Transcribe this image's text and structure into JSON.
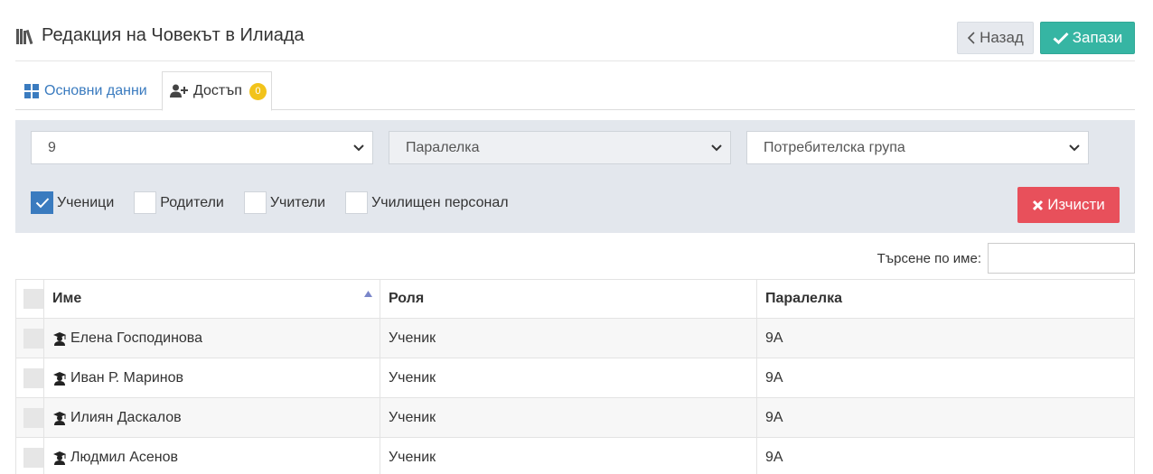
{
  "header": {
    "title": "Редакция на Човекът в Илиада",
    "back_label": "Назад",
    "save_label": "Запази"
  },
  "tabs": [
    {
      "label": "Основни данни"
    },
    {
      "label": "Достъп",
      "badge": "0"
    }
  ],
  "filters": {
    "class_value": "9",
    "section_placeholder": "Паралелка",
    "group_placeholder": "Потребителска група",
    "checkboxes": [
      {
        "label": "Ученици",
        "checked": true
      },
      {
        "label": "Родители",
        "checked": false
      },
      {
        "label": "Учители",
        "checked": false
      },
      {
        "label": "Училищен персонал",
        "checked": false
      }
    ],
    "clear_label": "Изчисти"
  },
  "search": {
    "label": "Търсене по име:",
    "value": ""
  },
  "table": {
    "columns": [
      "Име",
      "Роля",
      "Паралелка"
    ],
    "rows": [
      {
        "name": "Елена Господинова",
        "role": "Ученик",
        "section": "9А"
      },
      {
        "name": "Иван Р. Маринов",
        "role": "Ученик",
        "section": "9А"
      },
      {
        "name": "Илиян Даскалов",
        "role": "Ученик",
        "section": "9А"
      },
      {
        "name": "Людмил Асенов",
        "role": "Ученик",
        "section": "9А"
      }
    ]
  },
  "colors": {
    "primary_blue": "#3a7bbf",
    "save_teal": "#36b5a3",
    "clear_red": "#e8505b",
    "badge_yellow": "#f2c31a",
    "panel_bg": "#e3e7ed"
  },
  "icons": [
    "books-icon",
    "chevron-left-icon",
    "check-icon",
    "grid-icon",
    "user-plus-icon",
    "chevron-down-icon",
    "times-icon",
    "sort-up-icon",
    "graduate-icon"
  ]
}
